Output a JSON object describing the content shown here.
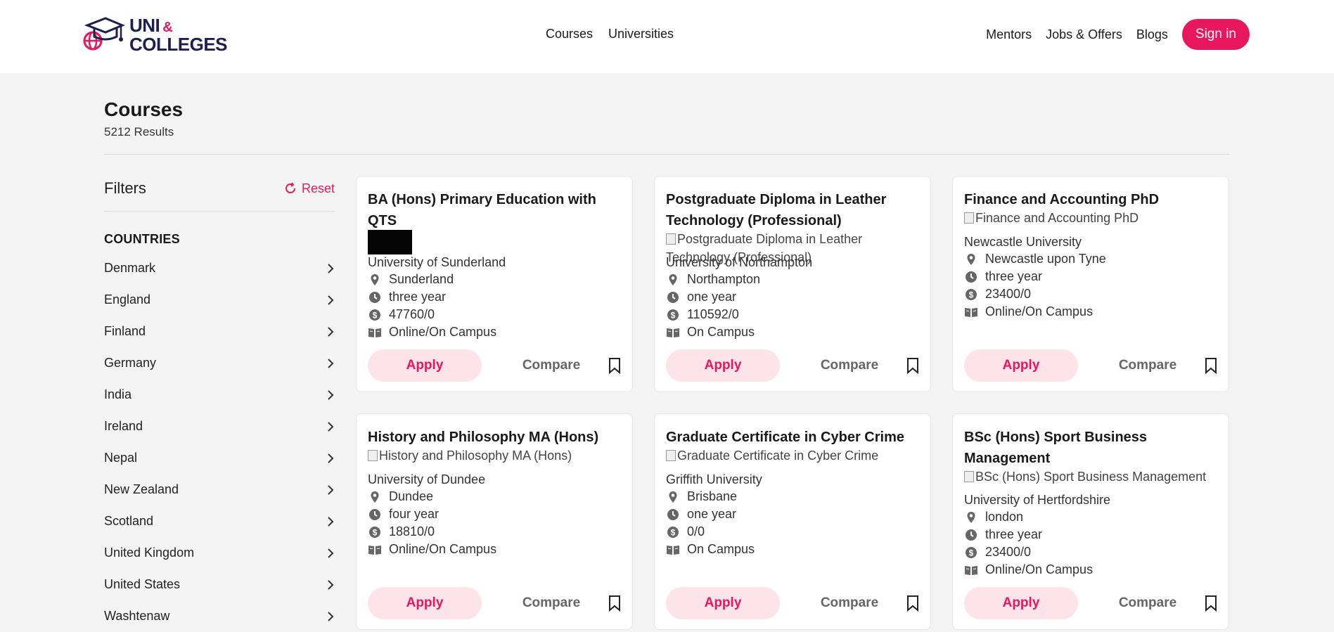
{
  "brand": {
    "line1": "UNI",
    "amp": "&",
    "line2": "COLLEGES"
  },
  "nav": {
    "center": [
      "Courses",
      "Universities"
    ],
    "right": [
      "Mentors",
      "Jobs & Offers",
      "Blogs"
    ],
    "signin": "Sign in"
  },
  "page": {
    "title": "Courses",
    "results": "5212 Results"
  },
  "filters": {
    "title": "Filters",
    "reset": "Reset",
    "countries_label": "COUNTRIES",
    "countries": [
      "Denmark",
      "England",
      "Finland",
      "Germany",
      "India",
      "Ireland",
      "Nepal",
      "New Zealand",
      "Scotland",
      "United Kingdom",
      "United States",
      "Washtenaw"
    ]
  },
  "card_actions": {
    "apply": "Apply",
    "compare": "Compare"
  },
  "cards": [
    {
      "title": "BA (Hons) Primary Education with QTS",
      "image_alt": "",
      "university": "University of Sunderland",
      "location": "Sunderland",
      "duration": "three year",
      "fee": "47760/0",
      "mode": "Online/On Campus"
    },
    {
      "title": "Postgraduate Diploma in Leather Technology (Professional)",
      "image_alt": "Postgraduate Diploma in Leather Technology (Professional)",
      "university": "University of Northampton",
      "location": "Northampton",
      "duration": "one year",
      "fee": "110592/0",
      "mode": "On Campus"
    },
    {
      "title": "Finance and Accounting PhD",
      "image_alt": "Finance and Accounting PhD",
      "university": "Newcastle University",
      "location": "Newcastle upon Tyne",
      "duration": "three year",
      "fee": "23400/0",
      "mode": "Online/On Campus"
    },
    {
      "title": "History and Philosophy MA (Hons)",
      "image_alt": "History and Philosophy MA (Hons)",
      "university": "University of Dundee",
      "location": "Dundee",
      "duration": "four year",
      "fee": "18810/0",
      "mode": "Online/On Campus"
    },
    {
      "title": "Graduate Certificate in Cyber Crime",
      "image_alt": "Graduate Certificate in Cyber Crime",
      "university": "Griffith University",
      "location": "Brisbane",
      "duration": "one year",
      "fee": "0/0",
      "mode": "On Campus"
    },
    {
      "title": "BSc (Hons) Sport Business Management",
      "image_alt": "BSc (Hons) Sport Business Management",
      "university": "University of Hertfordshire",
      "location": "london",
      "duration": "three year",
      "fee": "23400/0",
      "mode": "Online/On Campus"
    }
  ],
  "colors": {
    "accent": "#e8175d",
    "accent_soft": "#fde3ea",
    "brand_navy": "#1d1f4f",
    "page_bg": "#f4f4f4"
  }
}
